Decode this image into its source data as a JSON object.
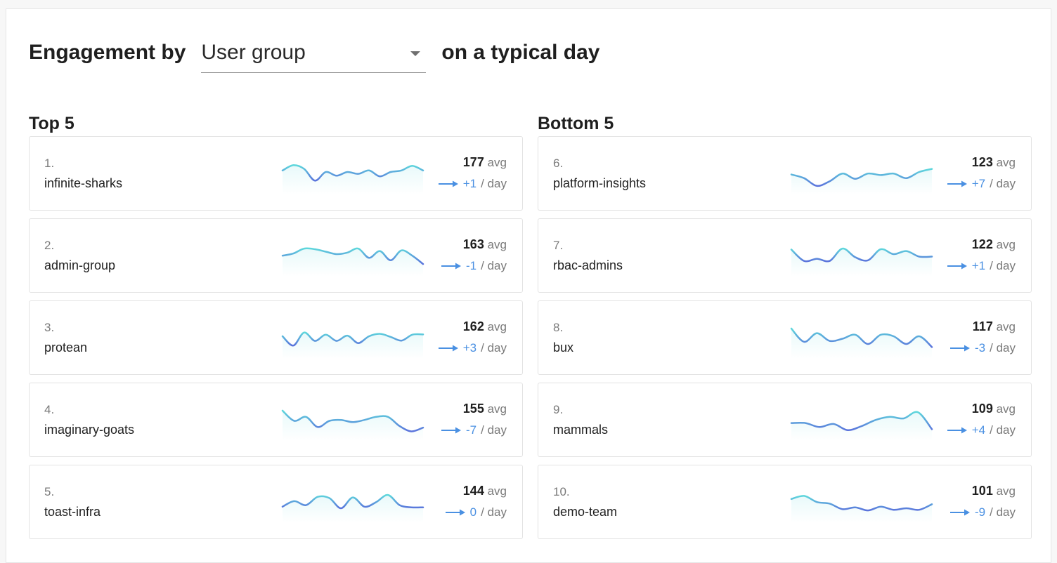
{
  "colors": {
    "accent": "#4a90e2",
    "spark_start": "#5ed8dc",
    "spark_end": "#5b73dc"
  },
  "header": {
    "prefix": "Engagement by",
    "group_select": {
      "value": "User group"
    },
    "suffix": "on a typical day"
  },
  "top": {
    "title": "Top 5",
    "items": [
      {
        "rank": "1.",
        "name": "infinite-sharks",
        "avg": "177",
        "avg_unit": "avg",
        "delta": "+1",
        "delta_unit": "/ day",
        "spark": [
          0.55,
          0.72,
          0.6,
          0.22,
          0.5,
          0.38,
          0.5,
          0.44,
          0.55,
          0.36,
          0.5,
          0.55,
          0.7,
          0.55
        ]
      },
      {
        "rank": "2.",
        "name": "admin-group",
        "avg": "163",
        "avg_unit": "avg",
        "delta": "-1",
        "delta_unit": "/ day",
        "spark": [
          0.45,
          0.52,
          0.68,
          0.66,
          0.58,
          0.5,
          0.55,
          0.68,
          0.38,
          0.6,
          0.3,
          0.62,
          0.45,
          0.18
        ]
      },
      {
        "rank": "3.",
        "name": "protean",
        "avg": "162",
        "avg_unit": "avg",
        "delta": "+3",
        "delta_unit": "/ day",
        "spark": [
          0.5,
          0.2,
          0.62,
          0.35,
          0.55,
          0.35,
          0.52,
          0.28,
          0.5,
          0.58,
          0.48,
          0.36,
          0.55,
          0.56
        ]
      },
      {
        "rank": "4.",
        "name": "imaginary-goats",
        "avg": "155",
        "avg_unit": "avg",
        "delta": "-7",
        "delta_unit": "/ day",
        "spark": [
          0.75,
          0.42,
          0.55,
          0.22,
          0.42,
          0.45,
          0.38,
          0.45,
          0.55,
          0.55,
          0.25,
          0.08,
          0.2
        ]
      },
      {
        "rank": "5.",
        "name": "toast-infra",
        "avg": "144",
        "avg_unit": "avg",
        "delta": "0",
        "delta_unit": "/ day",
        "spark": [
          0.3,
          0.48,
          0.35,
          0.62,
          0.58,
          0.25,
          0.6,
          0.3,
          0.45,
          0.68,
          0.35,
          0.28,
          0.28
        ]
      }
    ]
  },
  "bottom": {
    "title": "Bottom 5",
    "items": [
      {
        "rank": "6.",
        "name": "platform-insights",
        "avg": "123",
        "avg_unit": "avg",
        "delta": "+7",
        "delta_unit": "/ day",
        "spark": [
          0.42,
          0.3,
          0.05,
          0.2,
          0.45,
          0.28,
          0.45,
          0.4,
          0.45,
          0.3,
          0.5,
          0.6
        ]
      },
      {
        "rank": "7.",
        "name": "rbac-admins",
        "avg": "122",
        "avg_unit": "avg",
        "delta": "+1",
        "delta_unit": "/ day",
        "spark": [
          0.65,
          0.28,
          0.35,
          0.28,
          0.68,
          0.4,
          0.3,
          0.66,
          0.5,
          0.6,
          0.42,
          0.42
        ]
      },
      {
        "rank": "8.",
        "name": "bux",
        "avg": "117",
        "avg_unit": "avg",
        "delta": "-3",
        "delta_unit": "/ day",
        "spark": [
          0.75,
          0.32,
          0.6,
          0.35,
          0.42,
          0.55,
          0.25,
          0.55,
          0.5,
          0.25,
          0.5,
          0.15
        ]
      },
      {
        "rank": "9.",
        "name": "mammals",
        "avg": "109",
        "avg_unit": "avg",
        "delta": "+4",
        "delta_unit": "/ day",
        "spark": [
          0.35,
          0.35,
          0.22,
          0.32,
          0.12,
          0.25,
          0.45,
          0.55,
          0.5,
          0.7,
          0.15
        ]
      },
      {
        "rank": "10.",
        "name": "demo-team",
        "avg": "101",
        "avg_unit": "avg",
        "delta": "-9",
        "delta_unit": "/ day",
        "spark": [
          0.55,
          0.65,
          0.45,
          0.4,
          0.22,
          0.28,
          0.18,
          0.3,
          0.2,
          0.25,
          0.2,
          0.38
        ]
      }
    ]
  }
}
